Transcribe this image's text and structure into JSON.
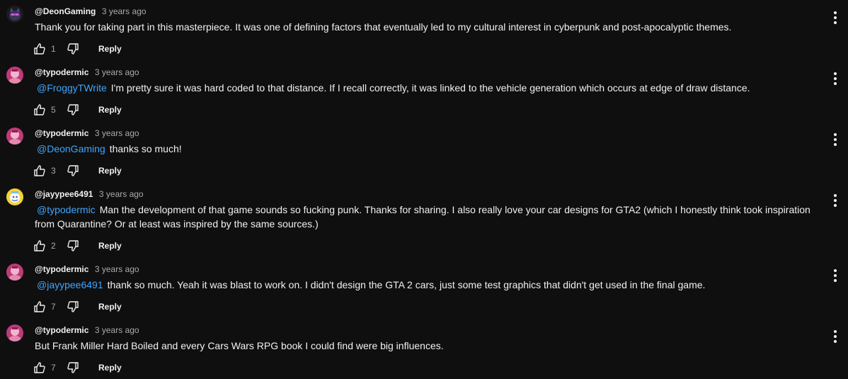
{
  "comments": [
    {
      "author": "@DeonGaming",
      "time": "3 years ago",
      "mention": "",
      "text": "Thank you for taking part in this masterpiece. It was one of defining factors that eventually led to my cultural interest in cyberpunk and post-apocalyptic themes.",
      "likes": "1",
      "reply_label": "Reply",
      "avatar": "cat-avatar"
    },
    {
      "author": "@typodermic",
      "time": "3 years ago",
      "mention": "@FroggyTWrite",
      "text": "I'm pretty sure it was hard coded to that distance. If I recall correctly, it was linked to the vehicle generation which occurs at edge of draw distance.",
      "likes": "5",
      "reply_label": "Reply",
      "avatar": "pink-portrait-avatar"
    },
    {
      "author": "@typodermic",
      "time": "3 years ago",
      "mention": "@DeonGaming",
      "text": "thanks so much!",
      "likes": "3",
      "reply_label": "Reply",
      "avatar": "pink-portrait-avatar"
    },
    {
      "author": "@jayypee6491",
      "time": "3 years ago",
      "mention": "@typodermic",
      "text": "Man the development of that game sounds so fucking punk. Thanks for sharing. I also really love your car designs for GTA2 (which I honestly think took inspiration from Quarantine? Or at least was inspired by the same sources.)",
      "likes": "2",
      "reply_label": "Reply",
      "avatar": "yellow-cartoon-avatar"
    },
    {
      "author": "@typodermic",
      "time": "3 years ago",
      "mention": "@jayypee6491",
      "text": "thank so much. Yeah it was blast to work on. I didn't design the GTA 2 cars, just some test graphics that didn't get used in the final game.",
      "likes": "7",
      "reply_label": "Reply",
      "avatar": "pink-portrait-avatar"
    },
    {
      "author": "@typodermic",
      "time": "3 years ago",
      "mention": "",
      "text": "But Frank Miller Hard Boiled and every Cars Wars RPG book I could find were big influences.",
      "likes": "7",
      "reply_label": "Reply",
      "avatar": "pink-portrait-avatar"
    }
  ],
  "colors": {
    "background": "#0f0f0f",
    "text": "#f1f1f1",
    "secondary_text": "#aaaaaa",
    "mention": "#3ea6ff"
  }
}
